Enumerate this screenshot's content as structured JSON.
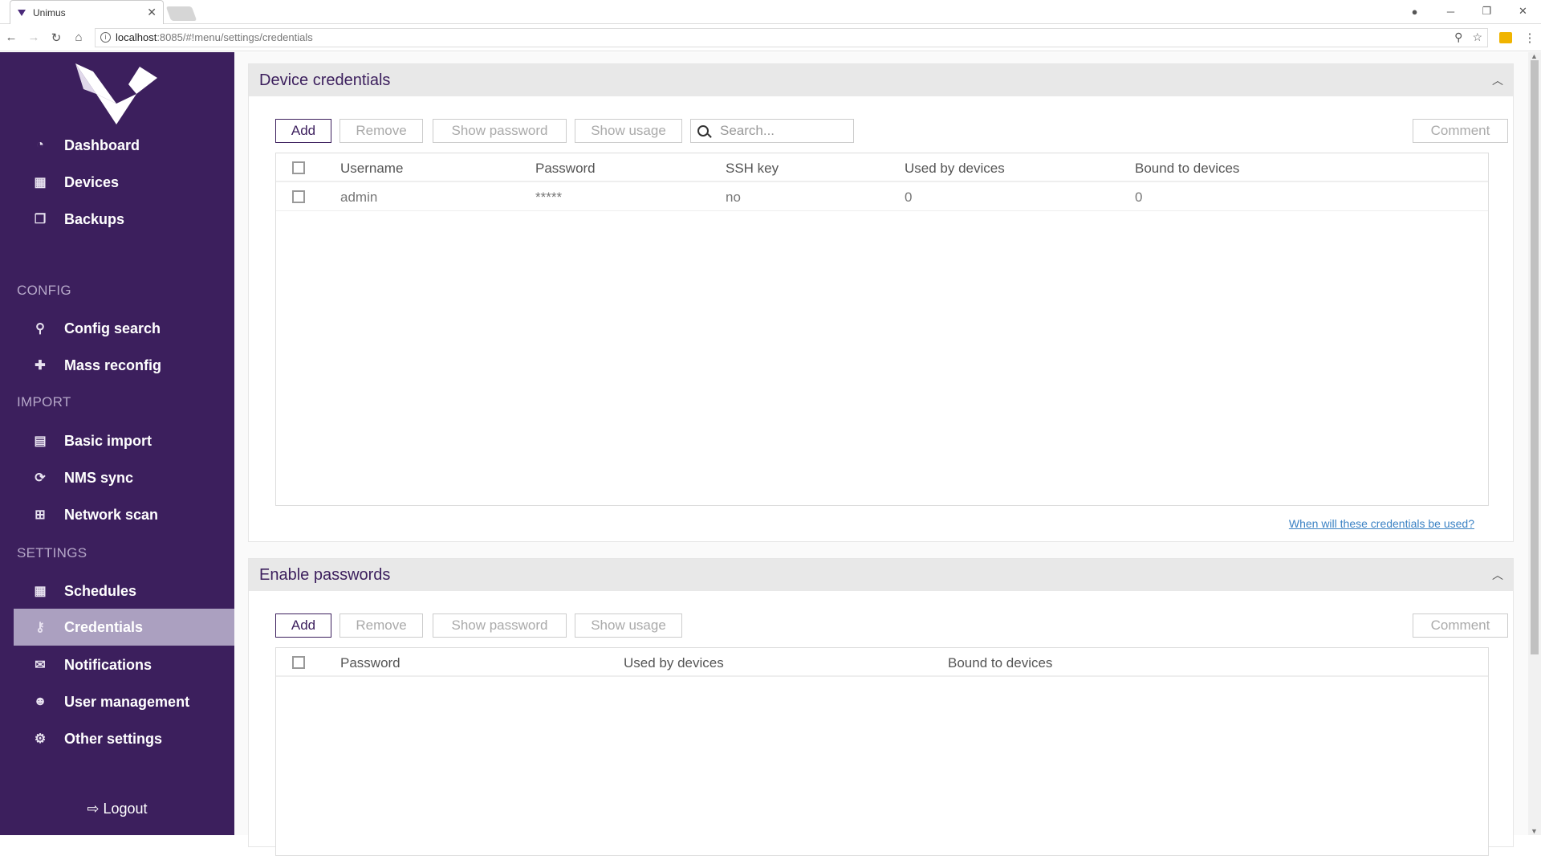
{
  "browser": {
    "tab_title": "Unimus",
    "tab_close": "✕",
    "url_host": "localhost",
    "url_path": ":8085/#!menu/settings/credentials",
    "win_min": "─",
    "win_max": "❐",
    "win_close": "✕"
  },
  "sidebar": {
    "items": [
      {
        "label": "Dashboard",
        "icon": "dashboard-icon",
        "glyph": "◔"
      },
      {
        "label": "Devices",
        "icon": "table-icon",
        "glyph": "▦"
      },
      {
        "label": "Backups",
        "icon": "copy-icon",
        "glyph": "❐"
      },
      {
        "label": "Config search",
        "icon": "search-icon",
        "glyph": "⚲"
      },
      {
        "label": "Mass reconfig",
        "icon": "puzzle-icon",
        "glyph": "✚"
      },
      {
        "label": "Basic import",
        "icon": "file-icon",
        "glyph": "▤"
      },
      {
        "label": "NMS sync",
        "icon": "refresh-icon",
        "glyph": "⟳"
      },
      {
        "label": "Network scan",
        "icon": "sitemap-icon",
        "glyph": "⊞"
      },
      {
        "label": "Schedules",
        "icon": "calendar-icon",
        "glyph": "▦"
      },
      {
        "label": "Credentials",
        "icon": "key-icon",
        "glyph": "⚷"
      },
      {
        "label": "Notifications",
        "icon": "envelope-icon",
        "glyph": "✉"
      },
      {
        "label": "User management",
        "icon": "users-icon",
        "glyph": "☻"
      },
      {
        "label": "Other settings",
        "icon": "cogs-icon",
        "glyph": "⚙"
      }
    ],
    "sections": {
      "config": "CONFIG",
      "import": "IMPORT",
      "settings": "SETTINGS"
    },
    "logout": "⇨ Logout",
    "active": "Credentials"
  },
  "device_credentials": {
    "title": "Device credentials",
    "buttons": {
      "add": "Add",
      "remove": "Remove",
      "show_password": "Show password",
      "show_usage": "Show usage",
      "comment": "Comment"
    },
    "search_placeholder": "Search...",
    "columns": [
      "Username",
      "Password",
      "SSH key",
      "Used by devices",
      "Bound to devices"
    ],
    "rows": [
      {
        "username": "admin",
        "password": "*****",
        "ssh_key": "no",
        "used_by": "0",
        "bound_to": "0"
      }
    ],
    "help_link": "When will these credentials be used?"
  },
  "enable_passwords": {
    "title": "Enable passwords",
    "buttons": {
      "add": "Add",
      "remove": "Remove",
      "show_password": "Show password",
      "show_usage": "Show usage",
      "comment": "Comment"
    },
    "columns": [
      "Password",
      "Used by devices",
      "Bound to devices"
    ]
  },
  "colors": {
    "sidebar": "#3c1f5d",
    "active_item": "#aba0c0",
    "accent": "#3c1f5d",
    "link": "#3b82c4"
  }
}
